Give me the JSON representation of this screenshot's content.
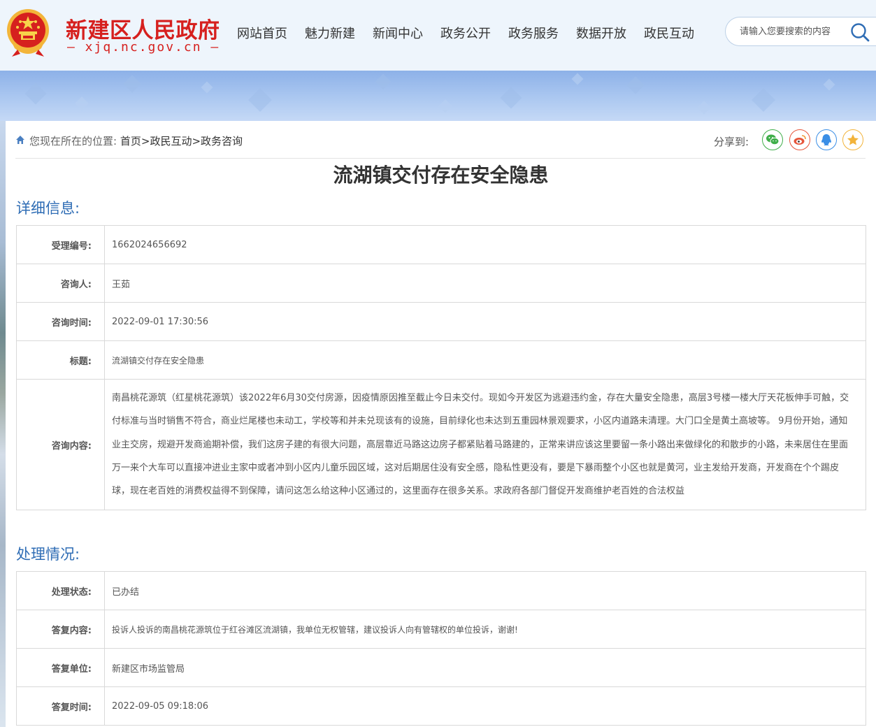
{
  "header": {
    "site_title": "新建区人民政府",
    "site_domain": "— xjq.nc.gov.cn —",
    "nav": [
      "网站首页",
      "魅力新建",
      "新闻中心",
      "政务公开",
      "政务服务",
      "数据开放",
      "政民互动"
    ],
    "search_placeholder": "请输入您要搜索的内容"
  },
  "breadcrumb": {
    "prefix": "您现在所在的位置:",
    "items": [
      "首页",
      "政民互动",
      "政务咨询"
    ],
    "sep": ">"
  },
  "share": {
    "label": "分享到:",
    "icons": [
      "wechat-icon",
      "weibo-icon",
      "qq-icon",
      "qzone-icon"
    ]
  },
  "article": {
    "title": "流湖镇交付存在安全隐患"
  },
  "details": {
    "section_title": "详细信息:",
    "rows": [
      {
        "label": "受理编号:",
        "value": "1662024656692"
      },
      {
        "label": "咨询人:",
        "value": "王茹"
      },
      {
        "label": "咨询时间:",
        "value": "2022-09-01 17:30:56"
      },
      {
        "label": "标题:",
        "value": "流湖镇交付存在安全隐患"
      },
      {
        "label": "咨询内容:",
        "value": "南昌桃花源筑（红星桃花源筑）该2022年6月30交付房源，因疫情原因推至截止今日未交付。现如今开发区为逃避违约金，存在大量安全隐患，高层3号楼一楼大厅天花板伸手可触，交付标准与当时销售不符合，商业烂尾楼也未动工，学校等和并未兑现该有的设施，目前绿化也未达到五重园林景观要求，小区内道路未清理。大门口全是黄土高坡等。 9月份开始，通知业主交房，规避开发商逾期补偿，我们这房子建的有很大问题，高层靠近马路这边房子都紧贴着马路建的，正常来讲应该这里要留一条小路出来做绿化的和散步的小路，未来居住在里面万一来个大车可以直接冲进业主家中或者冲到小区内儿童乐园区域，这对后期居住没有安全感，隐私性更没有，要是下暴雨整个小区也就是黄河，业主发给开发商，开发商在个个踢皮球，现在老百姓的消费权益得不到保障，请问这怎么给这种小区通过的，这里面存在很多关系。求政府各部门督促开发商维护老百姓的合法权益"
      }
    ]
  },
  "processing": {
    "section_title": "处理情况:",
    "rows": [
      {
        "label": "处理状态:",
        "value": "已办结"
      },
      {
        "label": "答复内容:",
        "value": "投诉人投诉的南昌桃花源筑位于红谷滩区流湖镇，我单位无权管辖，建议投诉人向有管辖权的单位投诉，谢谢!"
      },
      {
        "label": "答复单位:",
        "value": "新建区市场监管局"
      },
      {
        "label": "答复时间:",
        "value": "2022-09-05 09:18:06"
      }
    ]
  },
  "colors": {
    "brand_red": "#d6201e",
    "section_blue": "#2f6db5",
    "header_bg": "#eef5fc"
  }
}
